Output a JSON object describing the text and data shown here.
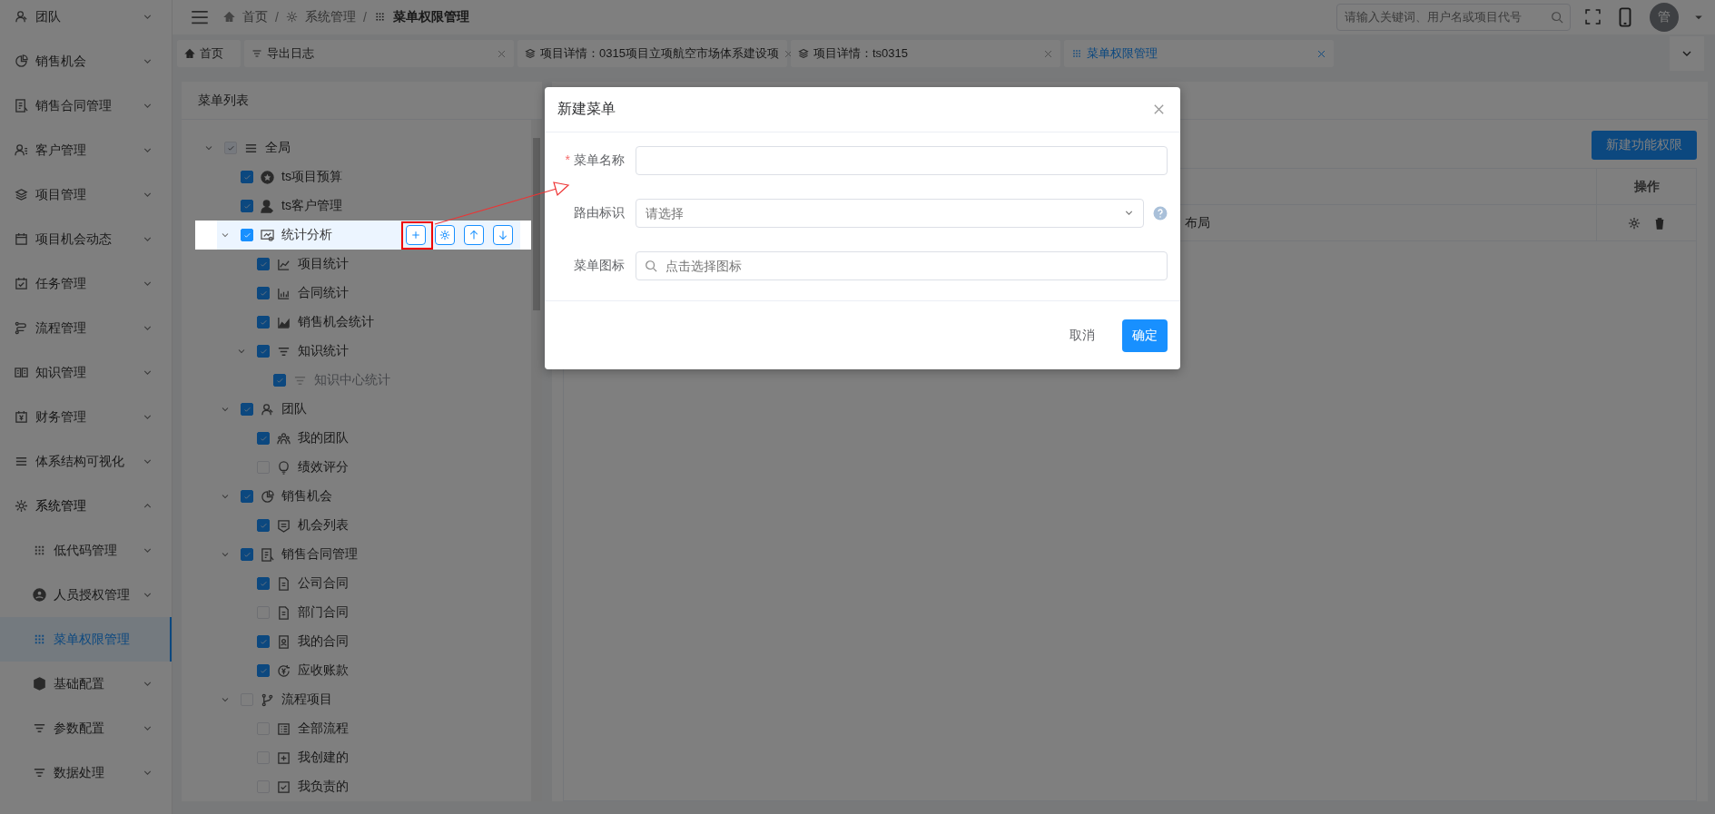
{
  "sidebar": {
    "items": [
      {
        "label": "团队",
        "kind": "group",
        "expanded": false,
        "selected": false
      },
      {
        "label": "销售机会",
        "kind": "group",
        "expanded": false,
        "selected": false
      },
      {
        "label": "销售合同管理",
        "kind": "group",
        "expanded": false,
        "selected": false
      },
      {
        "label": "客户管理",
        "kind": "group",
        "expanded": false,
        "selected": false
      },
      {
        "label": "项目管理",
        "kind": "group",
        "expanded": false,
        "selected": false
      },
      {
        "label": "项目机会动态",
        "kind": "group",
        "expanded": false,
        "selected": false
      },
      {
        "label": "任务管理",
        "kind": "group",
        "expanded": false,
        "selected": false
      },
      {
        "label": "流程管理",
        "kind": "group",
        "expanded": false,
        "selected": false
      },
      {
        "label": "知识管理",
        "kind": "group",
        "expanded": false,
        "selected": false
      },
      {
        "label": "财务管理",
        "kind": "group",
        "expanded": false,
        "selected": false
      },
      {
        "label": "体系结构可视化",
        "kind": "group",
        "expanded": false,
        "selected": false
      },
      {
        "label": "系统管理",
        "kind": "group",
        "expanded": true,
        "selected": false,
        "children": [
          {
            "label": "低代码管理",
            "kind": "group",
            "expanded": false,
            "selected": false
          },
          {
            "label": "人员授权管理",
            "kind": "group",
            "expanded": false,
            "selected": false
          },
          {
            "label": "菜单权限管理",
            "kind": "page",
            "selected": true
          },
          {
            "label": "基础配置",
            "kind": "group",
            "expanded": false,
            "selected": false
          },
          {
            "label": "参数配置",
            "kind": "group",
            "expanded": false,
            "selected": false
          },
          {
            "label": "数据处理",
            "kind": "group",
            "expanded": false,
            "selected": false
          }
        ]
      }
    ]
  },
  "header": {
    "breadcrumb": [
      {
        "label": "首页",
        "current": false
      },
      {
        "label": "系统管理",
        "current": false
      },
      {
        "label": "菜单权限管理",
        "current": true
      }
    ],
    "separator": "/",
    "search": {
      "placeholder": "请输入关键词、用户名或项目代号"
    },
    "avatar": "管"
  },
  "tabs": [
    {
      "label": "首页",
      "selected": false,
      "closable": false
    },
    {
      "label": "导出日志",
      "selected": false,
      "closable": true
    },
    {
      "label": "项目详情：0315项目立项航空市场体系建设项",
      "selected": false,
      "closable": true
    },
    {
      "label": "项目详情：ts0315",
      "selected": false,
      "closable": true
    },
    {
      "label": "菜单权限管理",
      "selected": true,
      "closable": true
    }
  ],
  "menu_panel": {
    "title": "菜单列表",
    "tree": [
      {
        "label": "全局",
        "checked": true,
        "disabled": true,
        "inactive": false,
        "highlighted": false,
        "expanded": true,
        "children": [
          {
            "label": "ts项目预算",
            "checked": true,
            "disabled": false,
            "inactive": false,
            "highlighted": false
          },
          {
            "label": "ts客户管理",
            "checked": true,
            "disabled": false,
            "inactive": false,
            "highlighted": false
          },
          {
            "label": "统计分析",
            "checked": true,
            "disabled": false,
            "inactive": false,
            "highlighted": true,
            "expanded": true,
            "children": [
              {
                "label": "项目统计",
                "checked": true,
                "disabled": false,
                "inactive": false,
                "highlighted": false
              },
              {
                "label": "合同统计",
                "checked": true,
                "disabled": false,
                "inactive": false,
                "highlighted": false
              },
              {
                "label": "销售机会统计",
                "checked": true,
                "disabled": false,
                "inactive": false,
                "highlighted": false
              },
              {
                "label": "知识统计",
                "checked": true,
                "disabled": false,
                "inactive": false,
                "highlighted": false,
                "expanded": true,
                "children": [
                  {
                    "label": "知识中心统计",
                    "checked": true,
                    "disabled": false,
                    "inactive": true,
                    "highlighted": false
                  }
                ]
              }
            ]
          },
          {
            "label": "团队",
            "checked": true,
            "disabled": false,
            "inactive": false,
            "highlighted": false,
            "expanded": true,
            "children": [
              {
                "label": "我的团队",
                "checked": true,
                "disabled": false,
                "inactive": false,
                "highlighted": false
              },
              {
                "label": "绩效评分",
                "checked": false,
                "disabled": false,
                "inactive": false,
                "highlighted": false
              }
            ]
          },
          {
            "label": "销售机会",
            "checked": true,
            "disabled": false,
            "inactive": false,
            "highlighted": false,
            "expanded": true,
            "children": [
              {
                "label": "机会列表",
                "checked": true,
                "disabled": false,
                "inactive": false,
                "highlighted": false
              }
            ]
          },
          {
            "label": "销售合同管理",
            "checked": true,
            "disabled": false,
            "inactive": false,
            "highlighted": false,
            "expanded": true,
            "children": [
              {
                "label": "公司合同",
                "checked": true,
                "disabled": false,
                "inactive": false,
                "highlighted": false
              },
              {
                "label": "部门合同",
                "checked": false,
                "disabled": false,
                "inactive": false,
                "highlighted": false
              },
              {
                "label": "我的合同",
                "checked": true,
                "disabled": false,
                "inactive": false,
                "highlighted": false
              },
              {
                "label": "应收账款",
                "checked": true,
                "disabled": false,
                "inactive": false,
                "highlighted": false
              }
            ]
          },
          {
            "label": "流程项目",
            "checked": false,
            "disabled": false,
            "inactive": false,
            "highlighted": false,
            "expanded": true,
            "children": [
              {
                "label": "全部流程",
                "checked": false,
                "disabled": false,
                "inactive": false,
                "highlighted": false
              },
              {
                "label": "我创建的",
                "checked": false,
                "disabled": false,
                "inactive": false,
                "highlighted": false
              },
              {
                "label": "我负责的",
                "checked": false,
                "disabled": false,
                "inactive": false,
                "highlighted": false
              }
            ]
          }
        ]
      }
    ]
  },
  "right_panel": {
    "new_button": "新建功能权限",
    "table": {
      "columns": [
        {
          "label": "操作"
        }
      ],
      "rows": [
        {
          "cells": [
            "布局"
          ]
        }
      ]
    }
  },
  "modal": {
    "title": "新建菜单",
    "required_mark": "*",
    "fields": [
      {
        "kind": "text",
        "label": "菜单名称",
        "required": true,
        "help": false
      },
      {
        "kind": "select",
        "label": "路由标识",
        "required": false,
        "placeholder": "请选择",
        "help": true
      },
      {
        "kind": "icon-picker",
        "label": "菜单图标",
        "required": false,
        "placeholder": "点击选择图标",
        "help": false
      }
    ],
    "buttons": [
      {
        "kind": "text",
        "label": "取消"
      },
      {
        "kind": "primary",
        "label": "确定"
      }
    ]
  },
  "overlay": {
    "dimmed": true
  }
}
